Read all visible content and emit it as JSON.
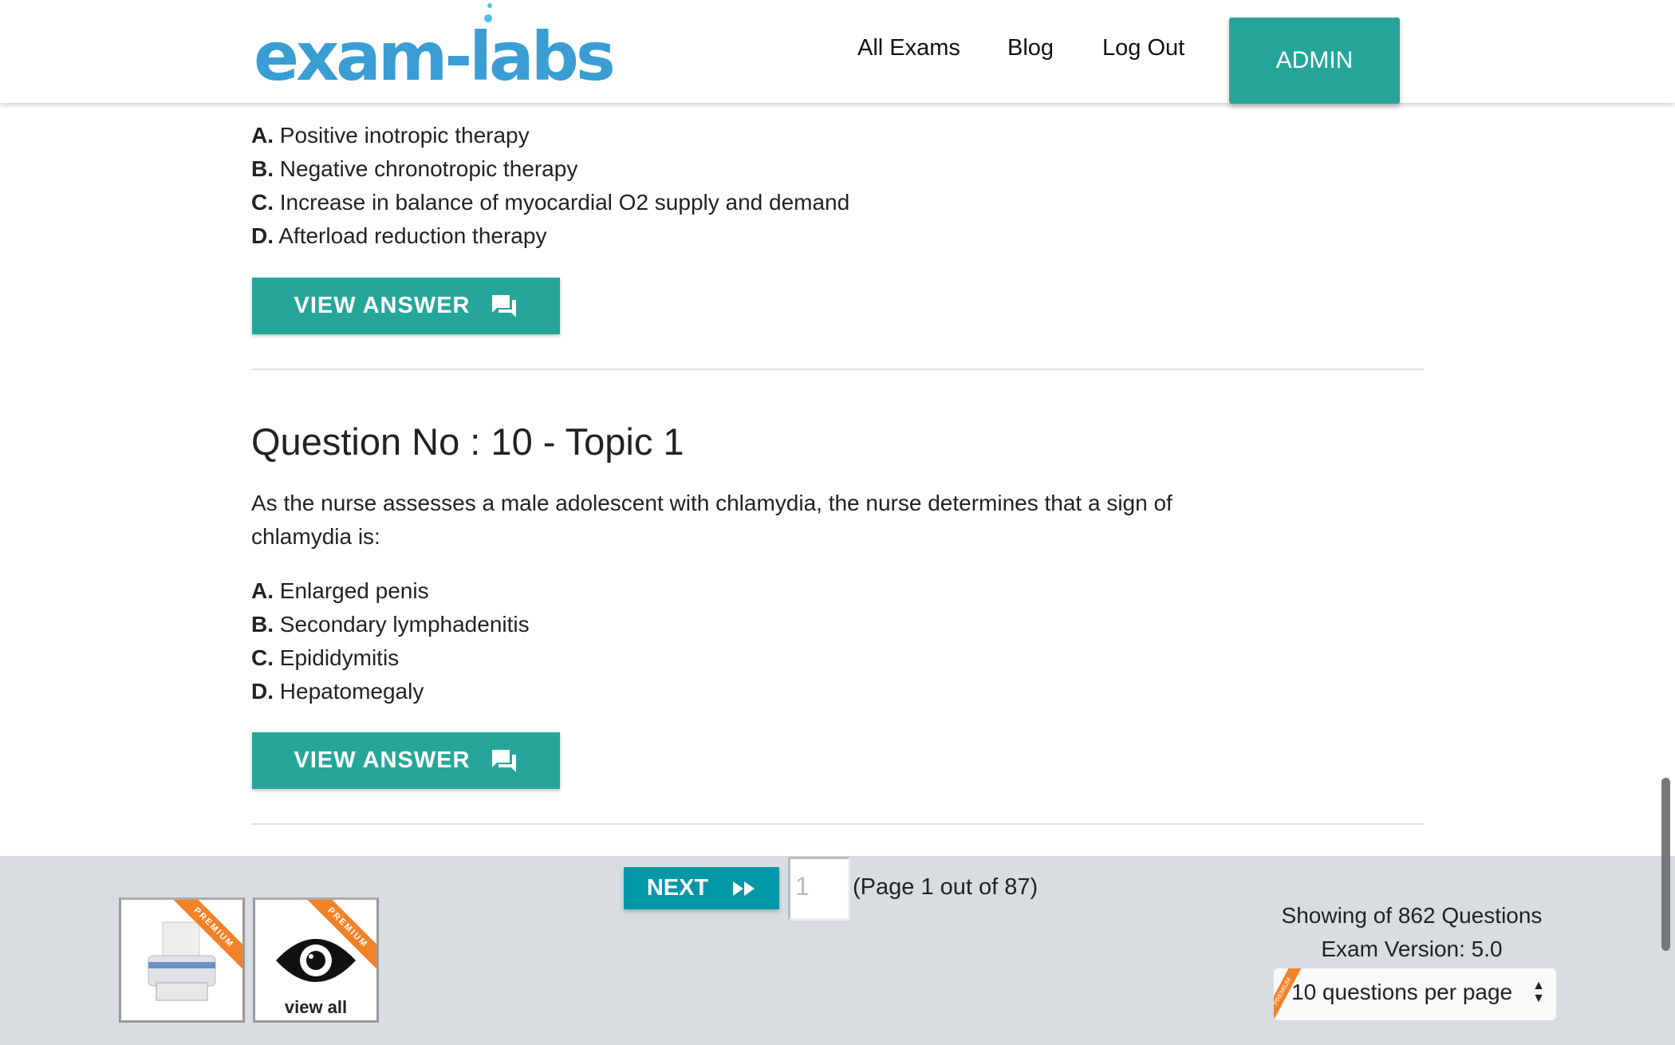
{
  "header": {
    "logo": "exam-labs",
    "nav": [
      "All Exams",
      "Blog",
      "Log Out"
    ],
    "admin_label": "ADMIN"
  },
  "prev_question": {
    "options": [
      {
        "letter": "A.",
        "text": "Positive inotropic therapy"
      },
      {
        "letter": "B.",
        "text": "Negative chronotropic therapy"
      },
      {
        "letter": "C.",
        "text": "Increase in balance of myocardial O2 supply and demand"
      },
      {
        "letter": "D.",
        "text": "Afterload reduction therapy"
      }
    ],
    "view_answer": "VIEW ANSWER"
  },
  "question": {
    "title": "Question No : 10 - Topic 1",
    "text": "As the nurse assesses a male adolescent with chlamydia, the nurse determines that a sign of chlamydia is:",
    "options": [
      {
        "letter": "A.",
        "text": "Enlarged penis"
      },
      {
        "letter": "B.",
        "text": "Secondary lymphadenitis"
      },
      {
        "letter": "C.",
        "text": "Epididymitis"
      },
      {
        "letter": "D.",
        "text": "Hepatomegaly"
      }
    ],
    "view_answer": "VIEW ANSWER"
  },
  "footer": {
    "next_label": "NEXT",
    "page_input": "1",
    "page_text": "(Page 1 out of 87)",
    "print_badge": "PREMIUM",
    "view_all_badge": "PREMIUM",
    "view_all_label": "view all",
    "showing": "Showing of 862 Questions",
    "version": "Exam Version: 5.0",
    "per_page": "10 questions per page",
    "select_badge": "PREMIUM"
  },
  "colors": {
    "accent": "#26a69a",
    "next": "#0097a7",
    "premium": "#f28228",
    "logo": "#3a9ed4"
  }
}
